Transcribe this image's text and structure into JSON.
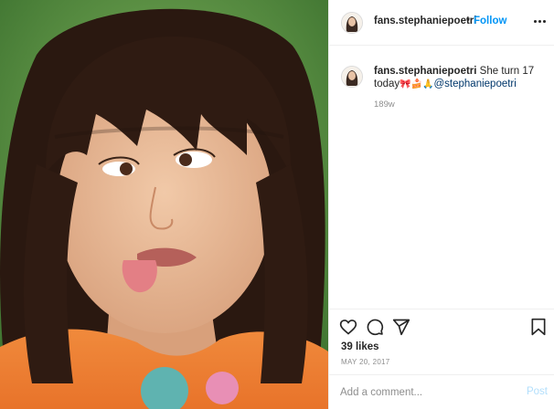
{
  "post": {
    "image_alt": "Photo",
    "colors": {
      "accent": "#0095f6",
      "mention": "#00376b",
      "muted": "#8e8e8e",
      "post_disabled": "#b2dffc"
    }
  },
  "header": {
    "username": "fans.stephaniepoetri",
    "separator": "•",
    "follow_label": "Follow",
    "avatar_icon": "avatar-icon",
    "more_icon": "more-options-icon"
  },
  "caption": {
    "username": "fans.stephaniepoetri",
    "text_before": "She turn 17 today",
    "emojis": "🎀🍰🙏",
    "mention": "@stephaniepoetri",
    "time_ago": "189w"
  },
  "actions": {
    "icons": [
      "heart-icon",
      "comment-icon",
      "share-icon",
      "bookmark-icon"
    ],
    "likes": "39 likes",
    "date": "MAY 20, 2017"
  },
  "comment": {
    "placeholder": "Add a comment...",
    "post_label": "Post"
  }
}
